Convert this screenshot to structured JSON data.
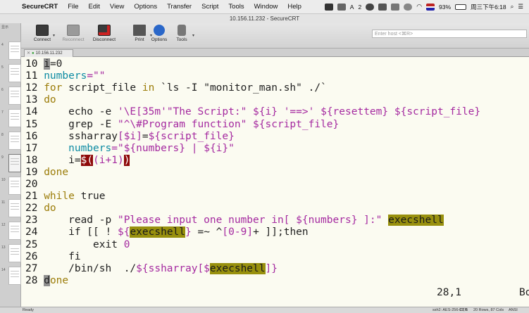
{
  "menubar": {
    "app_name": "SecureCRT",
    "items": [
      "File",
      "Edit",
      "View",
      "Options",
      "Transfer",
      "Script",
      "Tools",
      "Window",
      "Help"
    ],
    "status_a": "A",
    "status_num": "2",
    "battery": "93%",
    "clock": "周三下午6:18"
  },
  "window": {
    "title": "10.156.11.232 - SecureCRT"
  },
  "toolbar": {
    "connect": "Connect",
    "reconnect": "Reconnect",
    "disconnect": "Disconnect",
    "print": "Print",
    "options": "Options",
    "tools": "Tools",
    "host_placeholder": "Enter host <⌘R>"
  },
  "tab": {
    "label": "10.156.11.232"
  },
  "sidebar": {
    "label": "显示",
    "numbers": [
      "4",
      "5",
      "6",
      "7",
      "8",
      "9",
      "10",
      "11",
      "12",
      "13",
      "14"
    ]
  },
  "terminal": {
    "lines": [
      {
        "num": "10",
        "segs": [
          [
            "i",
            "curs"
          ],
          [
            "=0",
            "dk"
          ]
        ]
      },
      {
        "num": "11",
        "segs": [
          [
            "numbers",
            "var"
          ],
          [
            "=\"\"",
            "str"
          ]
        ]
      },
      {
        "num": "12",
        "segs": [
          [
            "for",
            "kw"
          ],
          [
            " script_file ",
            "dk"
          ],
          [
            "in",
            "kw"
          ],
          [
            " `ls -I \"monitor_man.sh\" ./`",
            "dk"
          ]
        ]
      },
      {
        "num": "13",
        "segs": [
          [
            "do",
            "kw"
          ]
        ]
      },
      {
        "num": "14",
        "segs": [
          [
            "    echo -e ",
            "dk"
          ],
          [
            "'\\E[35m'",
            "str"
          ],
          [
            "\"The Script:\"",
            "str"
          ],
          [
            " ${i}",
            "pur"
          ],
          [
            " '==>'",
            "str"
          ],
          [
            " ${resettem}",
            "pur"
          ],
          [
            " ${script_file}",
            "pur"
          ]
        ]
      },
      {
        "num": "15",
        "segs": [
          [
            "    grep -E ",
            "dk"
          ],
          [
            "\"^\\#Program function\"",
            "str"
          ],
          [
            " ${script_file}",
            "pur"
          ]
        ]
      },
      {
        "num": "16",
        "segs": [
          [
            "    ssharray",
            "dk"
          ],
          [
            "[$i]",
            "pur"
          ],
          [
            "=",
            "dk"
          ],
          [
            "${script_file}",
            "pur"
          ]
        ]
      },
      {
        "num": "17",
        "segs": [
          [
            "    numbers",
            "var"
          ],
          [
            "=\"",
            "str"
          ],
          [
            "${numbers}",
            "pur"
          ],
          [
            " | ",
            "str"
          ],
          [
            "${i}",
            "pur"
          ],
          [
            "\"",
            "str"
          ]
        ]
      },
      {
        "num": "18",
        "segs": [
          [
            "    i=",
            "dk"
          ],
          [
            "$(",
            "err"
          ],
          [
            "(i+1)",
            "pur"
          ],
          [
            ")",
            "err"
          ]
        ]
      },
      {
        "num": "19",
        "segs": [
          [
            "done",
            "kw"
          ]
        ]
      },
      {
        "num": "20",
        "segs": []
      },
      {
        "num": "21",
        "segs": [
          [
            "while",
            "kw"
          ],
          [
            " true",
            "dk"
          ]
        ]
      },
      {
        "num": "22",
        "segs": [
          [
            "do",
            "kw"
          ]
        ]
      },
      {
        "num": "23",
        "segs": [
          [
            "    read -p ",
            "dk"
          ],
          [
            "\"Please input one number in[ ",
            "str"
          ],
          [
            "${numbers}",
            "pur"
          ],
          [
            " ]:\"",
            "str"
          ],
          [
            " ",
            "dk"
          ],
          [
            "execshell",
            "hl"
          ]
        ]
      },
      {
        "num": "24",
        "segs": [
          [
            "    if [[ ! ",
            "dk"
          ],
          [
            "${",
            "pur"
          ],
          [
            "execshell",
            "hl"
          ],
          [
            "}",
            "pur"
          ],
          [
            " =~ ^",
            "dk"
          ],
          [
            "[0-9]",
            "pur"
          ],
          [
            "+ ]];then",
            "dk"
          ]
        ]
      },
      {
        "num": "25",
        "segs": [
          [
            "        exit ",
            "dk"
          ],
          [
            "0",
            "pur"
          ]
        ]
      },
      {
        "num": "26",
        "segs": [
          [
            "    fi",
            "dk"
          ]
        ]
      },
      {
        "num": "27",
        "segs": [
          [
            "    /bin/sh  ./",
            "dk"
          ],
          [
            "${ssharray[$",
            "pur"
          ],
          [
            "execshell",
            "hl"
          ],
          [
            "]}",
            "pur"
          ]
        ]
      },
      {
        "num": "28",
        "segs": [
          [
            "d",
            "curs"
          ],
          [
            "one",
            "kw"
          ]
        ]
      }
    ],
    "cursor_pos": "28,1",
    "scroll_pos": "Bo"
  },
  "statusbar": {
    "ready": "Ready",
    "cipher": "ssh2: AES-256-CTR",
    "cursor": "19,  5",
    "size": "20 Rows, 87 Cols",
    "term": "ANSI"
  },
  "colors": {
    "terminal_bg": "#fbfbf1",
    "keyword": "#9c7d0a",
    "variable": "#0d8ba3",
    "string": "#a52aa0",
    "highlight": "#98900e",
    "error_bg": "#8e0a0a"
  }
}
